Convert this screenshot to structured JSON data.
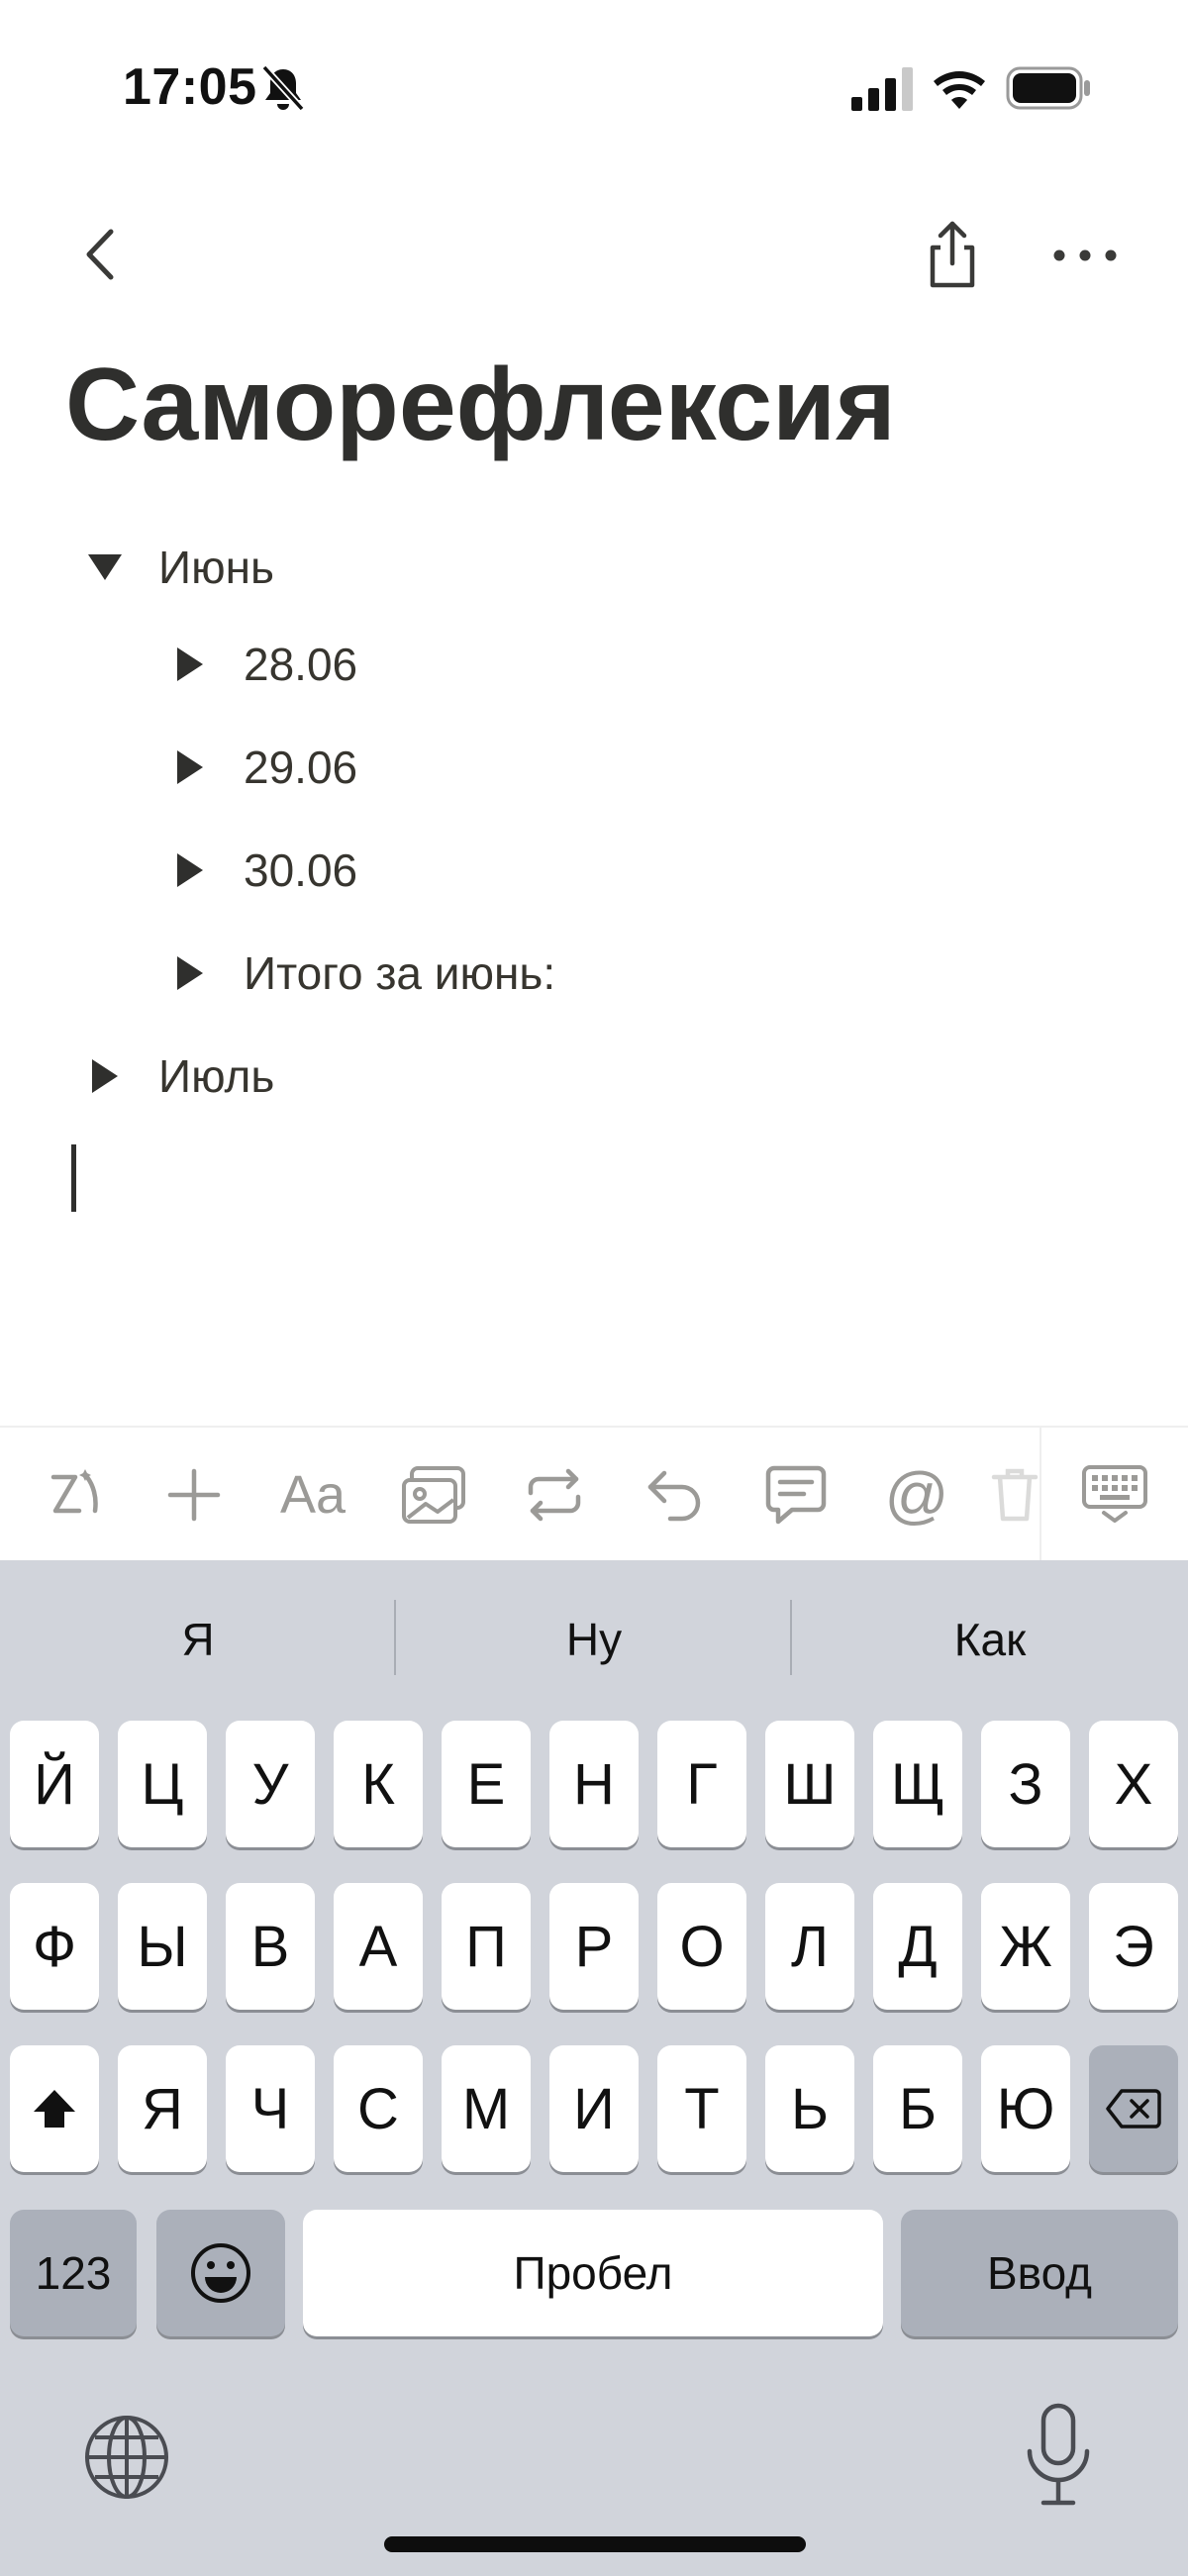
{
  "status_bar": {
    "time": "17:05",
    "icons": [
      "bell-slash-icon",
      "signal-icon",
      "wifi-icon",
      "battery-icon"
    ]
  },
  "nav": {
    "icons": [
      "chevron-left-icon",
      "share-icon",
      "more-horizontal-icon"
    ]
  },
  "page": {
    "title": "Саморефлексия",
    "toggles": [
      {
        "label": "Июнь",
        "expanded": true,
        "level": 0
      },
      {
        "label": "28.06",
        "expanded": false,
        "level": 1
      },
      {
        "label": "29.06",
        "expanded": false,
        "level": 1
      },
      {
        "label": "30.06",
        "expanded": false,
        "level": 1
      },
      {
        "label": "Итого за июнь:",
        "expanded": false,
        "level": 1
      },
      {
        "label": "Июль",
        "expanded": false,
        "level": 0
      }
    ]
  },
  "toolbar": {
    "icons": [
      "ai-sparkle-icon",
      "plus-icon",
      "text-format-icon",
      "image-icon",
      "turn-into-icon",
      "undo-icon",
      "comment-icon",
      "mention-icon",
      "trash-icon",
      "keyboard-dismiss-icon"
    ],
    "text_format_label": "Aa",
    "mention_label": "@"
  },
  "keyboard": {
    "suggestions": [
      "Я",
      "Ну",
      "Как"
    ],
    "row1": [
      "Й",
      "Ц",
      "У",
      "К",
      "Е",
      "Н",
      "Г",
      "Ш",
      "Щ",
      "З",
      "Х"
    ],
    "row2": [
      "Ф",
      "Ы",
      "В",
      "А",
      "П",
      "Р",
      "О",
      "Л",
      "Д",
      "Ж",
      "Э"
    ],
    "row3": [
      "Я",
      "Ч",
      "С",
      "М",
      "И",
      "Т",
      "Ь",
      "Б",
      "Ю"
    ],
    "numbers_label": "123",
    "space_label": "Пробел",
    "return_label": "Ввод",
    "icons": [
      "shift-icon",
      "backspace-icon",
      "emoji-icon",
      "globe-icon",
      "microphone-icon"
    ]
  },
  "colors": {
    "text": "#37352f",
    "keyboard_bg": "#d1d4db",
    "key_bg": "#ffffff",
    "dark_key_bg": "#abb0ba",
    "toolbar_icon": "#9b9a97"
  }
}
